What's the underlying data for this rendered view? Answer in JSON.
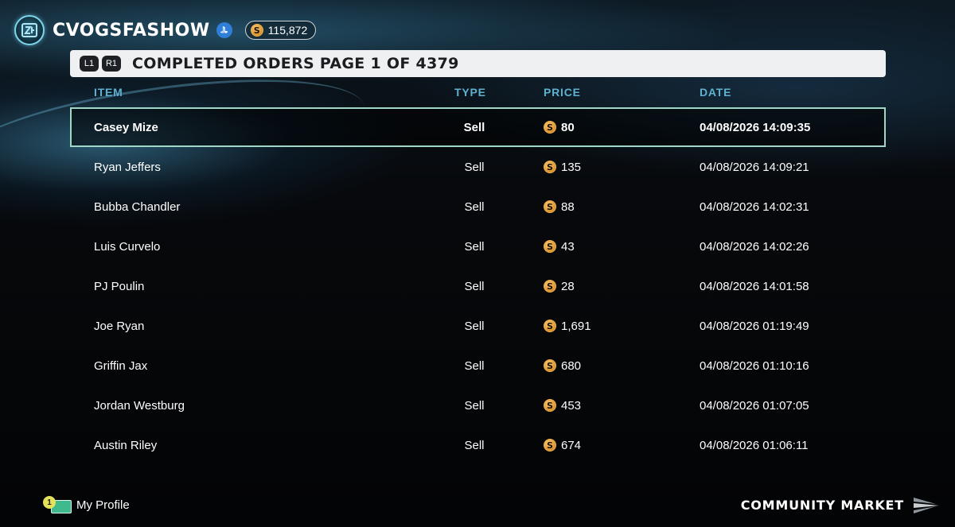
{
  "header": {
    "username": "CVOGSFASHOW",
    "platform_icon": "playstation-icon",
    "stubs_balance": "115,872",
    "currency_symbol": "S"
  },
  "title_bar": {
    "left_button": "L1",
    "right_button": "R1",
    "title": "COMPLETED ORDERS PAGE 1 OF 4379"
  },
  "table": {
    "columns": {
      "item": "ITEM",
      "type": "TYPE",
      "price": "PRICE",
      "date": "DATE"
    },
    "rows": [
      {
        "item": "Casey Mize",
        "type": "Sell",
        "price": "80",
        "date": "04/08/2026 14:09:35",
        "selected": true
      },
      {
        "item": "Ryan Jeffers",
        "type": "Sell",
        "price": "135",
        "date": "04/08/2026 14:09:21"
      },
      {
        "item": "Bubba Chandler",
        "type": "Sell",
        "price": "88",
        "date": "04/08/2026 14:02:31"
      },
      {
        "item": "Luis Curvelo",
        "type": "Sell",
        "price": "43",
        "date": "04/08/2026 14:02:26"
      },
      {
        "item": "PJ Poulin",
        "type": "Sell",
        "price": "28",
        "date": "04/08/2026 14:01:58"
      },
      {
        "item": "Joe Ryan",
        "type": "Sell",
        "price": "1,691",
        "date": "04/08/2026 01:19:49"
      },
      {
        "item": "Griffin Jax",
        "type": "Sell",
        "price": "680",
        "date": "04/08/2026 01:10:16"
      },
      {
        "item": "Jordan Westburg",
        "type": "Sell",
        "price": "453",
        "date": "04/08/2026 01:07:05"
      },
      {
        "item": "Austin Riley",
        "type": "Sell",
        "price": "674",
        "date": "04/08/2026 01:06:11"
      }
    ]
  },
  "footer": {
    "profile_badge": "1",
    "profile_label": "My Profile",
    "market_label": "COMMUNITY MARKET"
  },
  "colors": {
    "accent": "#5fb1cf",
    "selection_border": "#9fd8c6",
    "coin": "#d8902a",
    "title_bar_bg": "#eef0f2"
  }
}
